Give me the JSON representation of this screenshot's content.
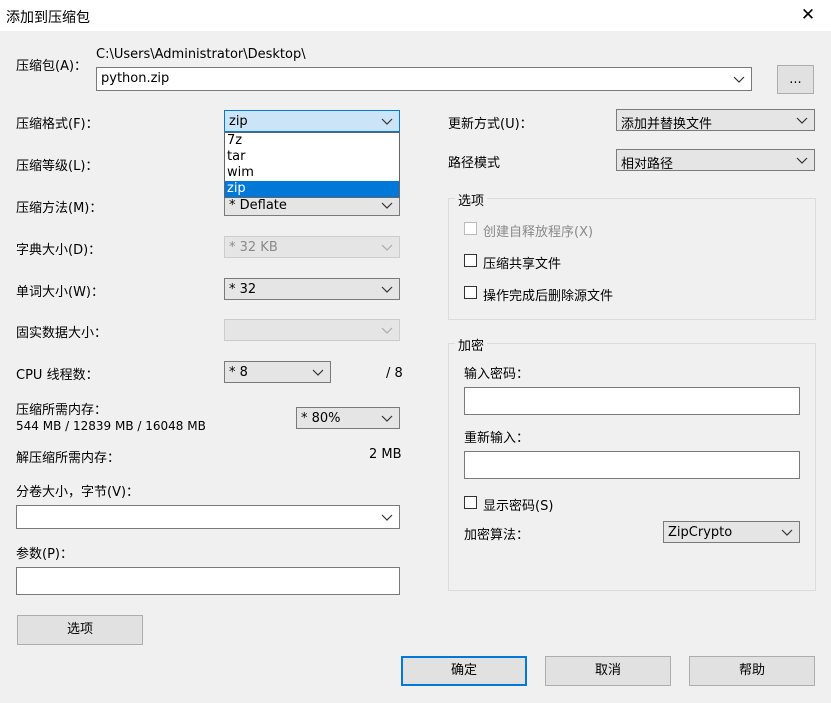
{
  "window": {
    "title": "添加到压缩包",
    "close_glyph": "✕"
  },
  "archive": {
    "label": "压缩包(A)：",
    "path": "C:\\Users\\Administrator\\Desktop\\",
    "filename": "python.zip",
    "browse_label": "..."
  },
  "left": {
    "format_label": "压缩格式(F)：",
    "format_value": "zip",
    "format_options": [
      "7z",
      "tar",
      "wim",
      "zip"
    ],
    "format_selected": "zip",
    "level_label": "压缩等级(L)：",
    "method_label": "压缩方法(M)：",
    "method_value": "* Deflate",
    "dict_label": "字典大小(D)：",
    "dict_value": "* 32 KB",
    "word_label": "单词大小(W)：",
    "word_value": "* 32",
    "solid_label": "固实数据大小：",
    "solid_value": "",
    "cpu_label": "CPU 线程数：",
    "cpu_value": "* 8",
    "cpu_max": "/ 8",
    "mem_label": "压缩所需内存：",
    "mem_value": "544 MB / 12839 MB / 16048 MB",
    "mem_percent": "* 80%",
    "decomp_label": "解压缩所需内存：",
    "decomp_value": "2 MB",
    "split_label": "分卷大小，字节(V)：",
    "split_value": "",
    "params_label": "参数(P)：",
    "params_value": "",
    "options_button": "选项"
  },
  "right": {
    "update_label": "更新方式(U)：",
    "update_value": "添加并替换文件",
    "path_label": "路径模式",
    "path_value": "相对路径",
    "options_group": "选项",
    "sfx_label": "创建自释放程序(X)",
    "shared_label": "压缩共享文件",
    "delete_label": "操作完成后删除源文件",
    "encrypt_group": "加密",
    "password_label": "输入密码：",
    "reenter_label": "重新输入：",
    "show_password_label": "显示密码(S)",
    "method_label": "加密算法：",
    "method_value": "ZipCrypto"
  },
  "buttons": {
    "ok": "确定",
    "cancel": "取消",
    "help": "帮助"
  }
}
